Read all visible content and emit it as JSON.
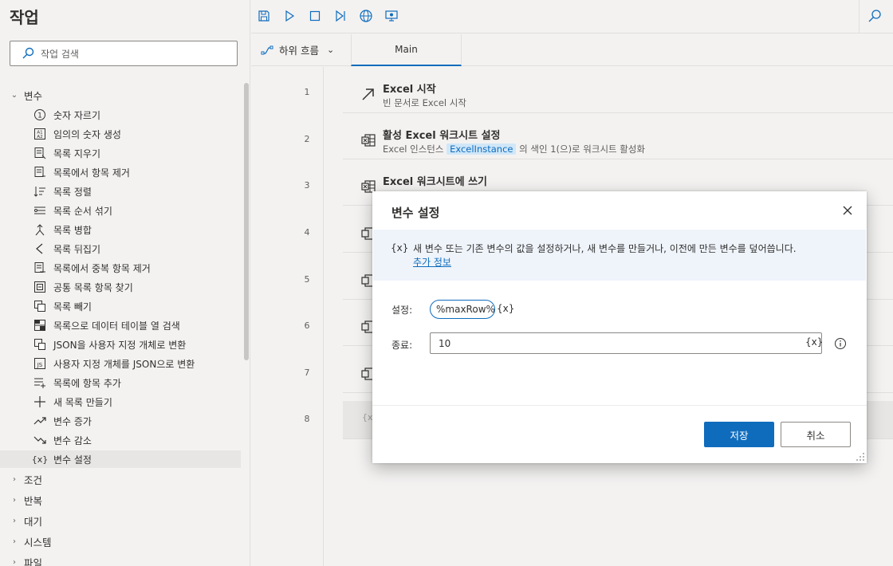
{
  "left": {
    "title": "작업",
    "search_placeholder": "작업 검색",
    "categories": [
      {
        "label": "변수",
        "expanded": true
      },
      {
        "label": "조건"
      },
      {
        "label": "반복"
      },
      {
        "label": "대기"
      },
      {
        "label": "시스템"
      },
      {
        "label": "파일"
      }
    ],
    "actions": [
      {
        "label": "숫자 자르기",
        "icon": "number-circle-icon"
      },
      {
        "label": "임의의 숫자 생성",
        "icon": "random-icon"
      },
      {
        "label": "목록 지우기",
        "icon": "list-clear-icon"
      },
      {
        "label": "목록에서 항목 제거",
        "icon": "list-remove-icon"
      },
      {
        "label": "목록 정렬",
        "icon": "sort-icon"
      },
      {
        "label": "목록 순서 섞기",
        "icon": "shuffle-icon"
      },
      {
        "label": "목록 병합",
        "icon": "merge-icon"
      },
      {
        "label": "목록 뒤집기",
        "icon": "reverse-icon"
      },
      {
        "label": "목록에서 중복 항목 제거",
        "icon": "dedupe-icon"
      },
      {
        "label": "공통 목록 항목 찾기",
        "icon": "common-icon"
      },
      {
        "label": "목록 빼기",
        "icon": "subtract-icon"
      },
      {
        "label": "목록으로 데이터 테이블 열 검색",
        "icon": "table-icon"
      },
      {
        "label": "JSON을 사용자 지정 개체로 변환",
        "icon": "json-object-icon"
      },
      {
        "label": "사용자 지정 개체를 JSON으로 변환",
        "icon": "object-json-icon"
      },
      {
        "label": "목록에 항목 추가",
        "icon": "list-add-icon"
      },
      {
        "label": "새 목록 만들기",
        "icon": "plus-icon"
      },
      {
        "label": "변수 증가",
        "icon": "increase-icon"
      },
      {
        "label": "변수 감소",
        "icon": "decrease-icon"
      },
      {
        "label": "변수 설정",
        "icon": "variable-icon",
        "selected": true
      }
    ]
  },
  "tabs": {
    "subflow_label": "하위 흐름",
    "main_label": "Main"
  },
  "flow": {
    "line_numbers": [
      "1",
      "2",
      "3",
      "4",
      "5",
      "6",
      "7",
      "8"
    ],
    "steps": [
      {
        "title": "Excel 시작",
        "desc": "빈 문서로 Excel 시작",
        "icon": "arrow-launch-icon"
      },
      {
        "title": "활성 Excel 워크시트 설정",
        "desc_pre": "Excel 인스턴스 ",
        "desc_var": "ExcelInstance",
        "desc_post": " 의 색인 1(으)로 워크시트 활성화",
        "icon": "excel-icon"
      },
      {
        "title": "Excel 워크시트에 쓰기",
        "icon": "excel-icon"
      }
    ],
    "step8_partial": "{x"
  },
  "dialog": {
    "title": "변수 설정",
    "info_icon": "{x}",
    "info_text": "새 변수 또는 기존 변수의 값을 설정하거나, 새 변수를 만들거나, 이전에 만든 변수를 덮어씁니다.",
    "info_link": "추가 정보",
    "set_label": "설정:",
    "var_name": "%maxRow%",
    "var_button": "{x}",
    "value_label": "종료:",
    "value": "10",
    "value_var_button": "{x}",
    "save_label": "저장",
    "cancel_label": "취소"
  },
  "colors": {
    "accent": "#0f6cbd",
    "pane_bg": "#f3f2f1"
  }
}
